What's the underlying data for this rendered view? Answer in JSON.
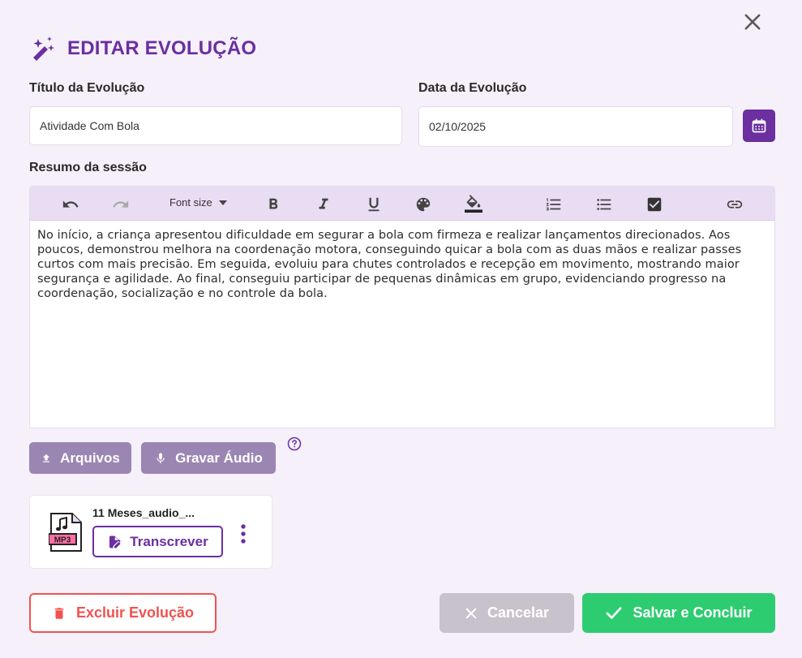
{
  "header": {
    "title": "EDITAR EVOLUÇÃO",
    "icon": "auto-awesome-icon",
    "close_icon": "close-icon"
  },
  "form": {
    "title_label": "Título da Evolução",
    "title_value": "Atividade Com Bola",
    "date_label": "Data da Evolução",
    "date_value": "02/10/2025",
    "calendar_icon": "calendar-icon",
    "summary_label": "Resumo da sessão"
  },
  "toolbar": {
    "font_size_label": "Font size",
    "tools": [
      "undo-icon",
      "redo-icon",
      "bold-icon",
      "italic-icon",
      "underline-icon",
      "text-color-icon",
      "highlight-icon",
      "numbered-list-icon",
      "bullet-list-icon",
      "checklist-icon",
      "link-icon"
    ]
  },
  "editor": {
    "content": "No início, a criança apresentou dificuldade em segurar a bola com firmeza e realizar lançamentos direcionados. Aos poucos, demonstrou melhora na coordenação motora, conseguindo quicar a bola com as duas mãos e realizar passes curtos com mais precisão. Em seguida, evoluiu para chutes controlados e recepção em movimento, mostrando maior segurança e agilidade. Ao final, conseguiu participar de pequenas dinâmicas em grupo, evidenciando progresso na coordenação, socialização e no controle da bola."
  },
  "attachments": {
    "files_label": "Arquivos",
    "record_label": "Gravar Áudio",
    "help_icon": "help-icon"
  },
  "file": {
    "name": "11 Meses_audio_...",
    "type_badge": "MP3",
    "transcribe_label": "Transcrever"
  },
  "footer": {
    "delete_label": "Excluir Evolução",
    "cancel_label": "Cancelar",
    "save_label": "Salvar e Concluir"
  },
  "colors": {
    "primary": "#6b2fa0",
    "muted_button": "#9b86b3",
    "danger": "#ef5350",
    "success": "#2ecc71",
    "background": "#f5f0fa"
  }
}
